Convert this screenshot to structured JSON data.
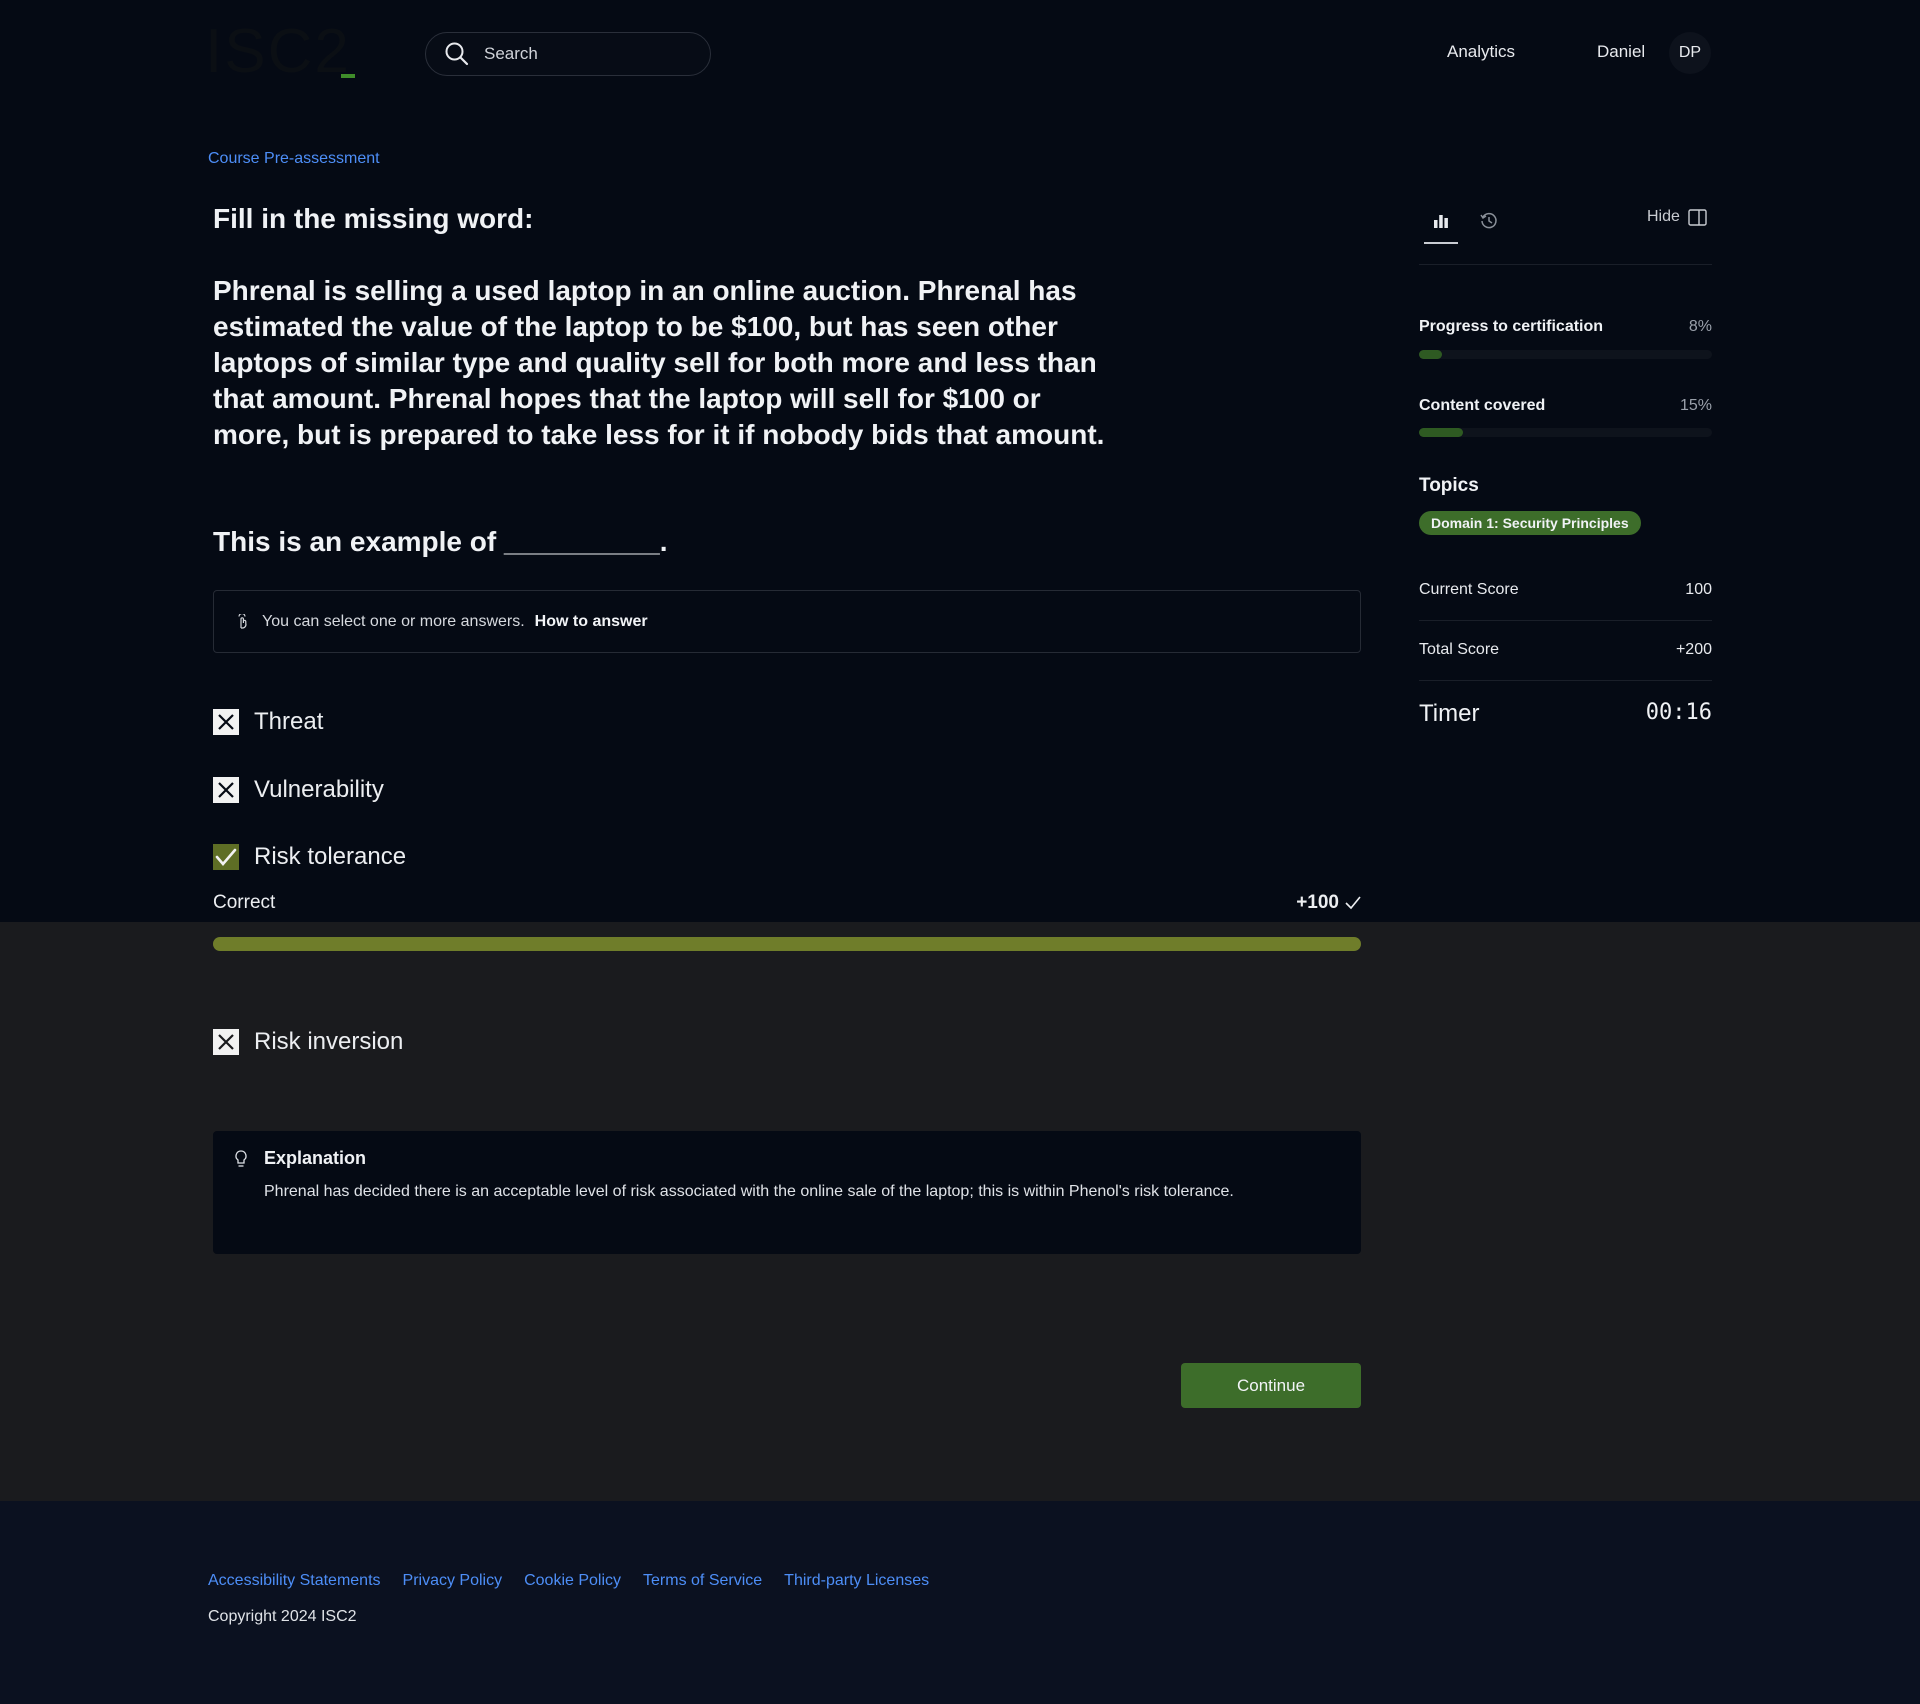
{
  "header": {
    "logo_text": "ISC2",
    "search_placeholder": "Search",
    "nav_analytics": "Analytics",
    "user_name": "Daniel",
    "avatar_initials": "DP"
  },
  "main": {
    "breadcrumb": "Course Pre-assessment",
    "question_title": "Fill in the missing word:",
    "question_body": "Phrenal is selling a used laptop in an online auction. Phrenal has estimated the value of the laptop to be $100, but has seen other laptops of similar type and quality sell for both more and less than that amount. Phrenal hopes that the laptop will sell for $100 or more, but is prepared to take less for it if nobody bids that amount.",
    "question_prompt": "This is an example of __________.",
    "hint_text": "You can select one or more answers.",
    "hint_link": "How to answer",
    "options": [
      {
        "label": "Threat",
        "state": "wrong"
      },
      {
        "label": "Vulnerability",
        "state": "wrong"
      },
      {
        "label": "Risk tolerance",
        "state": "correct"
      },
      {
        "label": "Risk inversion",
        "state": "wrong"
      }
    ],
    "result": {
      "label": "Correct",
      "points": "+100",
      "progress": 1.0
    },
    "explanation": {
      "title": "Explanation",
      "text": "Phrenal has decided there is an acceptable level of risk associated with the online sale of the laptop; this is within Phenol's risk tolerance."
    },
    "continue_label": "Continue"
  },
  "sidebar": {
    "hide_label": "Hide",
    "progress_cert": {
      "label": "Progress to certification",
      "value": "8%",
      "fraction": 0.08
    },
    "content_covered": {
      "label": "Content covered",
      "value": "15%",
      "fraction": 0.15
    },
    "topics_heading": "Topics",
    "topics": [
      "Domain 1: Security Principles"
    ],
    "current_score": {
      "label": "Current Score",
      "value": "100"
    },
    "total_score": {
      "label": "Total Score",
      "value": "+200"
    },
    "timer": {
      "label": "Timer",
      "value": "00:16"
    }
  },
  "footer": {
    "links": [
      "Accessibility Statements",
      "Privacy Policy",
      "Cookie Policy",
      "Terms of Service",
      "Third-party Licenses"
    ],
    "copyright": "Copyright 2024 ISC2"
  },
  "colors": {
    "background": "#050a14",
    "accent_green": "#3d6d2a",
    "correct_bar": "#6f7d2a",
    "link_blue": "#4d8ef7"
  }
}
